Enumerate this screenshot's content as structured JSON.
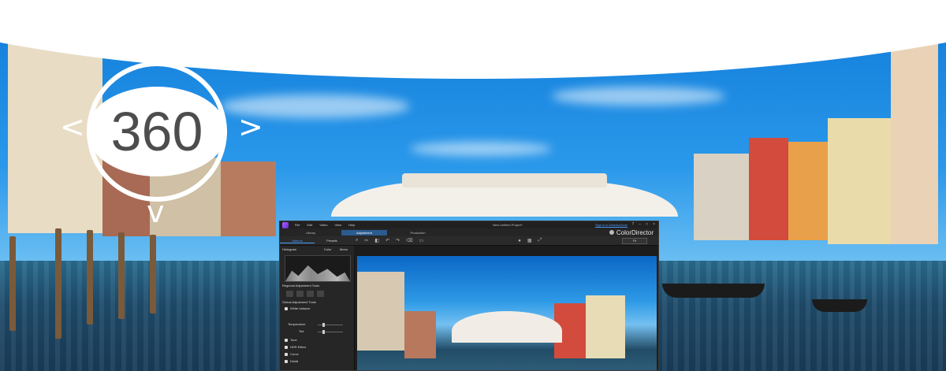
{
  "badge": {
    "label": "360",
    "arrows": {
      "up": "^",
      "down": "v",
      "left": "<",
      "right": ">"
    }
  },
  "app": {
    "menu": [
      "File",
      "Edit",
      "Video",
      "View",
      "Help"
    ],
    "project_title": "New Untitled Project*",
    "sign_in": "Sign in to DirectorZone",
    "window_controls": [
      "?",
      "–",
      "□",
      "×"
    ],
    "modes": [
      "Library",
      "Adjustment",
      "Production"
    ],
    "active_mode": "Adjustment",
    "brand": "ColorDirector",
    "tabs": [
      "Manual",
      "Presets"
    ],
    "active_tab": "Manual",
    "zoom": "Fit",
    "panel": {
      "histogram_label": "Histogram",
      "histogram_color": "Color",
      "histogram_value": "Mono",
      "regional_tools": "Regional Adjustment Tools",
      "global_tools": "Global Adjustment Tools",
      "white_balance": "White balance",
      "temperature": "Temperature",
      "tint": "Tint",
      "items": [
        "Tone",
        "HDR Effect",
        "Curve",
        "Detail"
      ]
    }
  }
}
